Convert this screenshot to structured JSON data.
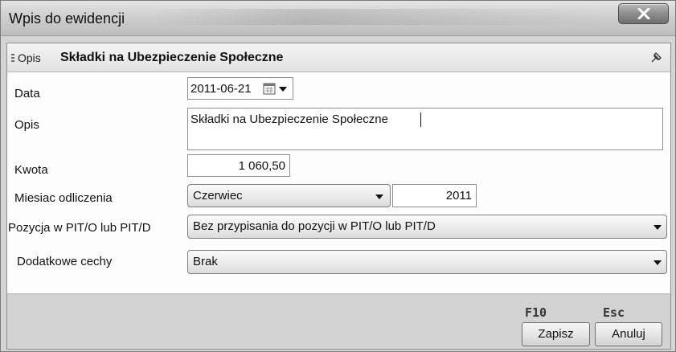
{
  "window": {
    "title": "Wpis do ewidencji"
  },
  "section": {
    "label": "Opis",
    "title": "Składki na Ubezpieczenie Społeczne"
  },
  "form": {
    "data_label": "Data",
    "data_value": "2011-06-21",
    "opis_label": "Opis",
    "opis_value": "Składki na Ubezpieczenie Społeczne",
    "kwota_label": "Kwota",
    "kwota_value": "1 060,50",
    "miesiac_label": "Miesiac odliczenia",
    "miesiac_value": "Czerwiec",
    "rok_value": "2011",
    "pozycja_label": "Pozycja w  PIT/O lub PIT/D",
    "pozycja_value": "Bez przypisania do pozycji w PIT/O lub PIT/D",
    "cechy_label": "Dodatkowe cechy",
    "cechy_value": "Brak"
  },
  "footer": {
    "save_key": "F10",
    "save_label": "Zapisz",
    "cancel_key": "Esc",
    "cancel_label": "Anuluj"
  },
  "icons": {
    "close": "close-icon",
    "calendar": "calendar-icon",
    "pin": "pin-icon",
    "dropdown": "chevron-down-icon"
  }
}
